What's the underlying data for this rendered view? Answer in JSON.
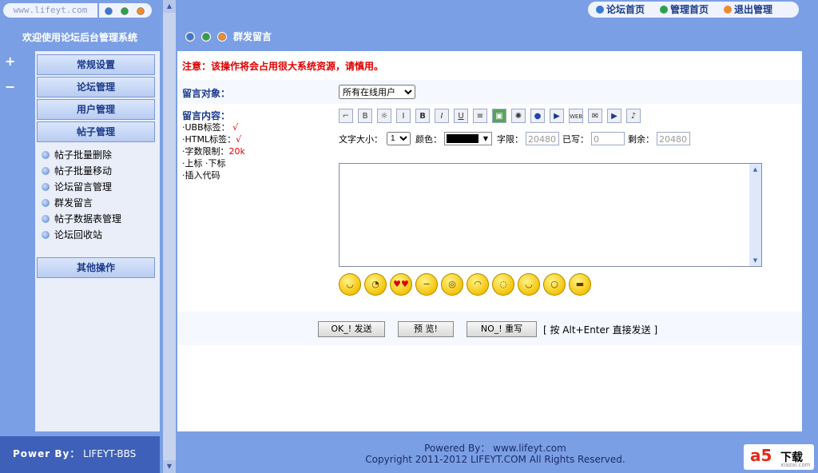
{
  "left": {
    "site_url": "www.lifeyt.com",
    "welcome": "欢迎使用论坛后台管理系统",
    "menu": [
      "常规设置",
      "论坛管理",
      "用户管理",
      "帖子管理"
    ],
    "submenu": [
      "帖子批量删除",
      "帖子批量移动",
      "论坛留言管理",
      "群发留言",
      "帖子数据表管理",
      "论坛回收站"
    ],
    "other": "其他操作",
    "footer_label": "Power By：",
    "footer_value": "LIFEYT-BBS"
  },
  "nav": {
    "home": "论坛首页",
    "admin": "管理首页",
    "logout": "退出管理"
  },
  "main": {
    "title": "群发留言",
    "warning": "注意：该操作将会占用很大系统资源，请慎用。",
    "target_label": "留言对象：",
    "target_value": "所有在线用户",
    "content_label": "留言内容：",
    "ubb": "·UBB标签：",
    "html": "·HTML标签：",
    "check": "√",
    "limit_label": "·字数限制：",
    "limit_value": "20k",
    "supsub": "·上标 ·下标",
    "insert_code": "·插入代码",
    "font_size_label": "文字大小：",
    "font_size_value": "1",
    "color_label": "颜色：",
    "chars_limit_label": "字限：",
    "chars_limit_value": "20480",
    "written_label": "已写：",
    "written_value": "0",
    "remaining_label": "剩余：",
    "remaining_value": "20480",
    "btn_send": "OK_! 发送",
    "btn_preview": "预  览!",
    "btn_reset": "NO_! 重写",
    "shortcut": "[ 按 Alt+Enter 直接发送 ]"
  },
  "footer": {
    "line1": "Powered By：  www.lifeyt.com",
    "line2": "Copyright 2011-2012 LIFEYT.COM All Rights Reserved."
  },
  "watermark": {
    "logo": "a5",
    "text": "下载",
    "site": "xiazai.com"
  },
  "toolbar_icons": [
    "ubb-tag-icon",
    "bold-outline-icon",
    "color-icon",
    "italic-outline-icon",
    "bold-icon",
    "italic-icon",
    "underline-icon",
    "center-icon",
    "image-icon",
    "flash-icon",
    "quote-icon",
    "media-icon",
    "link-icon",
    "email-icon",
    "play-icon",
    "sound-icon"
  ],
  "emoticons": [
    "grin",
    "wink",
    "love",
    "sly",
    "shock",
    "sad",
    "cry",
    "smile",
    "surprise",
    "cool"
  ],
  "colors": {
    "accent": "#7b9fe5",
    "warning": "#e00000",
    "label": "#1b3a8a"
  }
}
